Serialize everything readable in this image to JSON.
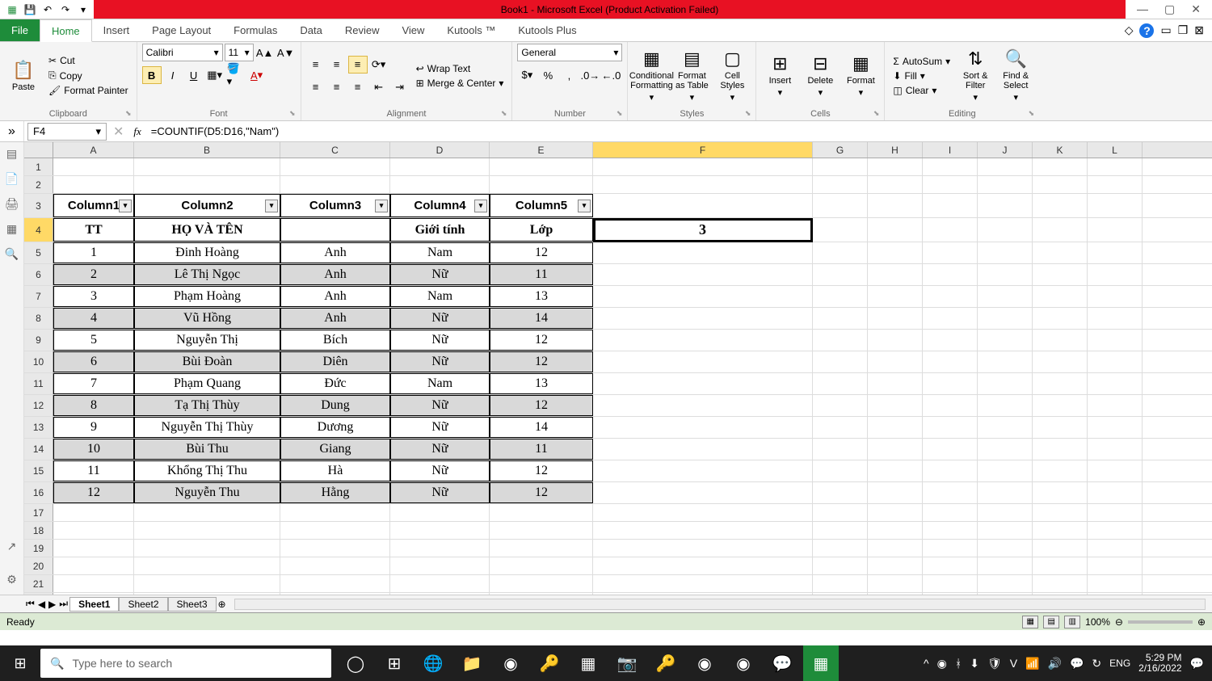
{
  "title": "Book1 - Microsoft Excel (Product Activation Failed)",
  "qat": {
    "save": "💾",
    "undo": "↶",
    "redo": "↷",
    "more": "▾"
  },
  "winbtns": {
    "min": "—",
    "max": "▢",
    "close": "✕"
  },
  "tabs": {
    "file": "File",
    "home": "Home",
    "insert": "Insert",
    "pagelayout": "Page Layout",
    "formulas": "Formulas",
    "data": "Data",
    "review": "Review",
    "view": "View",
    "kutools": "Kutools ™",
    "kutoolsplus": "Kutools Plus"
  },
  "ribbon": {
    "clipboard": {
      "label": "Clipboard",
      "paste": "Paste",
      "cut": "Cut",
      "copy": "Copy",
      "fmtpainter": "Format Painter"
    },
    "font": {
      "label": "Font",
      "name": "Calibri",
      "size": "11"
    },
    "alignment": {
      "label": "Alignment",
      "wrap": "Wrap Text",
      "merge": "Merge & Center"
    },
    "number": {
      "label": "Number",
      "fmt": "General"
    },
    "styles": {
      "label": "Styles",
      "cond": "Conditional Formatting",
      "table": "Format as Table",
      "cell": "Cell Styles"
    },
    "cells": {
      "label": "Cells",
      "insert": "Insert",
      "delete": "Delete",
      "format": "Format"
    },
    "editing": {
      "label": "Editing",
      "autosum": "AutoSum",
      "fill": "Fill",
      "clear": "Clear",
      "sort": "Sort & Filter",
      "find": "Find & Select"
    }
  },
  "namebox": "F4",
  "formula": "=COUNTIF(D5:D16,\"Nam\")",
  "columns": [
    "A",
    "B",
    "C",
    "D",
    "E",
    "F",
    "G",
    "H",
    "I",
    "J",
    "K",
    "L"
  ],
  "selected_col_index": 5,
  "selected_row": 4,
  "selected_value": "3",
  "headers3": [
    "Column1",
    "Column2",
    "Column3",
    "Column4",
    "Column5"
  ],
  "headers4": [
    "TT",
    "HỌ VÀ TÊN",
    "",
    "Giới tính",
    "Lớp"
  ],
  "table": [
    {
      "tt": "1",
      "ho": "Đinh Hoàng",
      "ten": "Anh",
      "gt": "Nam",
      "lop": "12"
    },
    {
      "tt": "2",
      "ho": "Lê Thị Ngọc",
      "ten": "Anh",
      "gt": "Nữ",
      "lop": "11"
    },
    {
      "tt": "3",
      "ho": "Phạm Hoàng",
      "ten": "Anh",
      "gt": "Nam",
      "lop": "13"
    },
    {
      "tt": "4",
      "ho": "Vũ Hồng",
      "ten": "Anh",
      "gt": "Nữ",
      "lop": "14"
    },
    {
      "tt": "5",
      "ho": "Nguyễn Thị",
      "ten": "Bích",
      "gt": "Nữ",
      "lop": "12"
    },
    {
      "tt": "6",
      "ho": "Bùi Đoàn",
      "ten": "Diên",
      "gt": "Nữ",
      "lop": "12"
    },
    {
      "tt": "7",
      "ho": "Phạm Quang",
      "ten": "Đức",
      "gt": "Nam",
      "lop": "13"
    },
    {
      "tt": "8",
      "ho": "Tạ Thị Thùy",
      "ten": "Dung",
      "gt": "Nữ",
      "lop": "12"
    },
    {
      "tt": "9",
      "ho": "Nguyễn Thị Thùy",
      "ten": "Dương",
      "gt": "Nữ",
      "lop": "14"
    },
    {
      "tt": "10",
      "ho": "Bùi Thu",
      "ten": "Giang",
      "gt": "Nữ",
      "lop": "11"
    },
    {
      "tt": "11",
      "ho": "Khổng Thị Thu",
      "ten": "Hà",
      "gt": "Nữ",
      "lop": "12"
    },
    {
      "tt": "12",
      "ho": "Nguyễn Thu",
      "ten": "Hằng",
      "gt": "Nữ",
      "lop": "12"
    }
  ],
  "sheets": [
    "Sheet1",
    "Sheet2",
    "Sheet3"
  ],
  "status": {
    "ready": "Ready",
    "zoom": "100%"
  },
  "taskbar": {
    "search": "Type here to search",
    "lang": "ENG",
    "time": "5:29 PM",
    "date": "2/16/2022"
  }
}
